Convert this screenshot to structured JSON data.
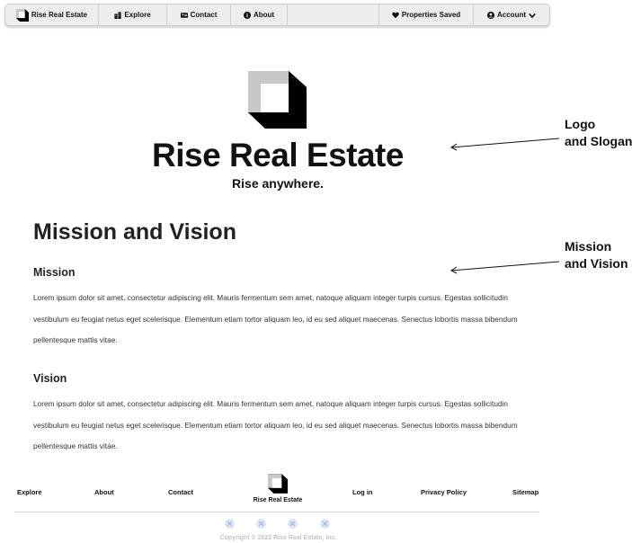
{
  "nav": {
    "brand": "Rise Real Estate",
    "explore": "Explore",
    "contact": "Contact",
    "about": "About",
    "saved": "Properties Saved",
    "account": "Account"
  },
  "hero": {
    "title": "Rise Real Estate",
    "slogan": "Rise anywhere."
  },
  "annotations": {
    "logo_line1": "Logo",
    "logo_line2": "and Slogan",
    "mission_line1": "Mission",
    "mission_line2": "and Vision"
  },
  "content": {
    "heading": "Mission and Vision",
    "mission_heading": "Mission",
    "mission_text": "Lorem ipsum dolor sit amet, consectetur adipiscing elit. Mauris fermentum sem amet, natoque aliquam integer turpis cursus. Egestas sollicitudin vestibulum eu feugiat netus eget scelerisque. Elementum etiam tortor aliquam leo, id eu sed aliquet maecenas. Senectus lobortis massa bibendum pellentesque mattis vitae.",
    "vision_heading": "Vision",
    "vision_text": "Lorem ipsum dolor sit amet, consectetur adipiscing elit. Mauris fermentum sem amet, natoque aliquam integer turpis cursus. Egestas sollicitudin vestibulum eu feugiat netus eget scelerisque. Elementum etiam tortor aliquam leo, id eu sed aliquet maecenas. Senectus lobortis massa bibendum pellentesque mattis vitae."
  },
  "footer": {
    "explore": "Explore",
    "about": "About",
    "contact": "Contact",
    "brand": "Rise Real Estate",
    "login": "Log in",
    "privacy": "Privacy Policy",
    "sitemap": "Sitemap",
    "social_icons": [
      "social-icon-1",
      "social-icon-2",
      "social-icon-3",
      "social-icon-4"
    ],
    "copyright": "Copyright © 2022 Rise Real Estate, Inc."
  },
  "icons": {
    "explore": "buildings-icon",
    "contact": "contact-card-icon",
    "about": "info-icon",
    "saved": "heart-icon",
    "account": "user-circle-icon",
    "account_caret": "chevron-down-icon"
  },
  "colors": {
    "nav_background": "#ededed",
    "logo_light": "#c8c8c8",
    "logo_dark": "#000000",
    "copyright_text": "#c4c4c4",
    "social_icon_bg": "#dfe6f5"
  }
}
